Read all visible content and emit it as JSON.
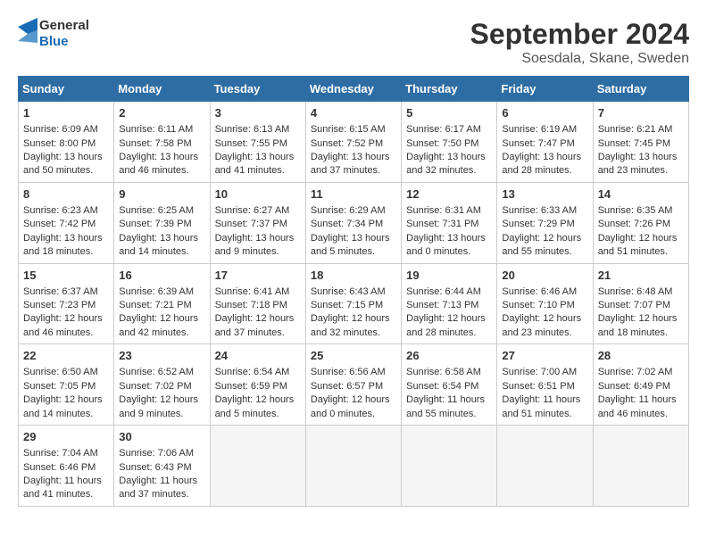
{
  "logo": {
    "line1": "General",
    "line2": "Blue"
  },
  "title": "September 2024",
  "subtitle": "Soesdala, Skane, Sweden",
  "days_of_week": [
    "Sunday",
    "Monday",
    "Tuesday",
    "Wednesday",
    "Thursday",
    "Friday",
    "Saturday"
  ],
  "weeks": [
    [
      {
        "day": 1,
        "sunrise": "6:09 AM",
        "sunset": "8:00 PM",
        "daylight": "13 hours and 50 minutes."
      },
      {
        "day": 2,
        "sunrise": "6:11 AM",
        "sunset": "7:58 PM",
        "daylight": "13 hours and 46 minutes."
      },
      {
        "day": 3,
        "sunrise": "6:13 AM",
        "sunset": "7:55 PM",
        "daylight": "13 hours and 41 minutes."
      },
      {
        "day": 4,
        "sunrise": "6:15 AM",
        "sunset": "7:52 PM",
        "daylight": "13 hours and 37 minutes."
      },
      {
        "day": 5,
        "sunrise": "6:17 AM",
        "sunset": "7:50 PM",
        "daylight": "13 hours and 32 minutes."
      },
      {
        "day": 6,
        "sunrise": "6:19 AM",
        "sunset": "7:47 PM",
        "daylight": "13 hours and 28 minutes."
      },
      {
        "day": 7,
        "sunrise": "6:21 AM",
        "sunset": "7:45 PM",
        "daylight": "13 hours and 23 minutes."
      }
    ],
    [
      {
        "day": 8,
        "sunrise": "6:23 AM",
        "sunset": "7:42 PM",
        "daylight": "13 hours and 18 minutes."
      },
      {
        "day": 9,
        "sunrise": "6:25 AM",
        "sunset": "7:39 PM",
        "daylight": "13 hours and 14 minutes."
      },
      {
        "day": 10,
        "sunrise": "6:27 AM",
        "sunset": "7:37 PM",
        "daylight": "13 hours and 9 minutes."
      },
      {
        "day": 11,
        "sunrise": "6:29 AM",
        "sunset": "7:34 PM",
        "daylight": "13 hours and 5 minutes."
      },
      {
        "day": 12,
        "sunrise": "6:31 AM",
        "sunset": "7:31 PM",
        "daylight": "13 hours and 0 minutes."
      },
      {
        "day": 13,
        "sunrise": "6:33 AM",
        "sunset": "7:29 PM",
        "daylight": "12 hours and 55 minutes."
      },
      {
        "day": 14,
        "sunrise": "6:35 AM",
        "sunset": "7:26 PM",
        "daylight": "12 hours and 51 minutes."
      }
    ],
    [
      {
        "day": 15,
        "sunrise": "6:37 AM",
        "sunset": "7:23 PM",
        "daylight": "12 hours and 46 minutes."
      },
      {
        "day": 16,
        "sunrise": "6:39 AM",
        "sunset": "7:21 PM",
        "daylight": "12 hours and 42 minutes."
      },
      {
        "day": 17,
        "sunrise": "6:41 AM",
        "sunset": "7:18 PM",
        "daylight": "12 hours and 37 minutes."
      },
      {
        "day": 18,
        "sunrise": "6:43 AM",
        "sunset": "7:15 PM",
        "daylight": "12 hours and 32 minutes."
      },
      {
        "day": 19,
        "sunrise": "6:44 AM",
        "sunset": "7:13 PM",
        "daylight": "12 hours and 28 minutes."
      },
      {
        "day": 20,
        "sunrise": "6:46 AM",
        "sunset": "7:10 PM",
        "daylight": "12 hours and 23 minutes."
      },
      {
        "day": 21,
        "sunrise": "6:48 AM",
        "sunset": "7:07 PM",
        "daylight": "12 hours and 18 minutes."
      }
    ],
    [
      {
        "day": 22,
        "sunrise": "6:50 AM",
        "sunset": "7:05 PM",
        "daylight": "12 hours and 14 minutes."
      },
      {
        "day": 23,
        "sunrise": "6:52 AM",
        "sunset": "7:02 PM",
        "daylight": "12 hours and 9 minutes."
      },
      {
        "day": 24,
        "sunrise": "6:54 AM",
        "sunset": "6:59 PM",
        "daylight": "12 hours and 5 minutes."
      },
      {
        "day": 25,
        "sunrise": "6:56 AM",
        "sunset": "6:57 PM",
        "daylight": "12 hours and 0 minutes."
      },
      {
        "day": 26,
        "sunrise": "6:58 AM",
        "sunset": "6:54 PM",
        "daylight": "11 hours and 55 minutes."
      },
      {
        "day": 27,
        "sunrise": "7:00 AM",
        "sunset": "6:51 PM",
        "daylight": "11 hours and 51 minutes."
      },
      {
        "day": 28,
        "sunrise": "7:02 AM",
        "sunset": "6:49 PM",
        "daylight": "11 hours and 46 minutes."
      }
    ],
    [
      {
        "day": 29,
        "sunrise": "7:04 AM",
        "sunset": "6:46 PM",
        "daylight": "11 hours and 41 minutes."
      },
      {
        "day": 30,
        "sunrise": "7:06 AM",
        "sunset": "6:43 PM",
        "daylight": "11 hours and 37 minutes."
      },
      null,
      null,
      null,
      null,
      null
    ]
  ]
}
